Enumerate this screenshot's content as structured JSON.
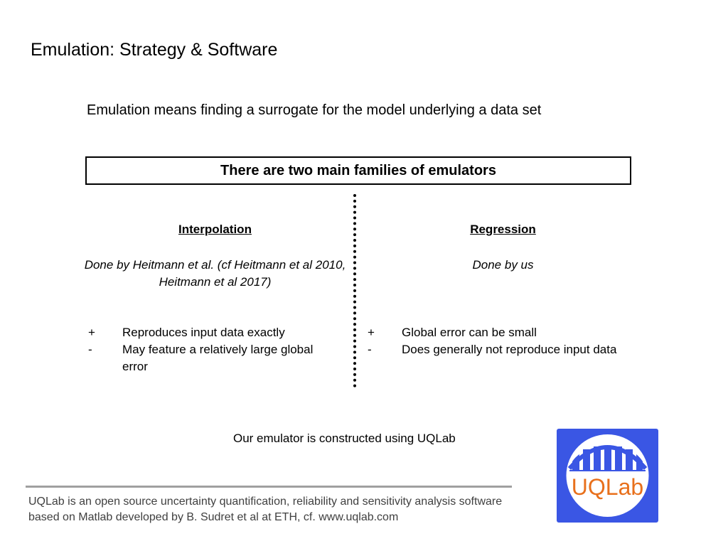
{
  "slide": {
    "title": "Emulation: Strategy & Software",
    "intro": "Emulation means finding a surrogate for the model underlying a data set",
    "families_box": "There are two main families of emulators",
    "columns": [
      {
        "heading": "Interpolation",
        "credit": "Done by Heitmann et al. (cf Heitmann et al 2010, Heitmann et al 2017)",
        "items": [
          {
            "sign": "+",
            "text": "Reproduces input data exactly"
          },
          {
            "sign": "-",
            "text": "May feature a relatively large global error"
          }
        ]
      },
      {
        "heading": "Regression",
        "credit": "Done by us",
        "items": [
          {
            "sign": "+",
            "text": "Global error can be small"
          },
          {
            "sign": "-",
            "text": "Does generally not reproduce input data"
          }
        ]
      }
    ],
    "uqlab_note": "Our emulator is constructed using UQLab",
    "footer": "UQLab is an open source uncertainty quantification, reliability and sensitivity analysis software based on Matlab developed by B. Sudret et al at ETH, cf. www.uqlab.com",
    "logo": {
      "text": "UQLab",
      "icon": "uqlab-bridge-logo",
      "colors": {
        "background": "#3a56e4",
        "text": "#e8701c",
        "circle": "#ffffff"
      }
    }
  }
}
